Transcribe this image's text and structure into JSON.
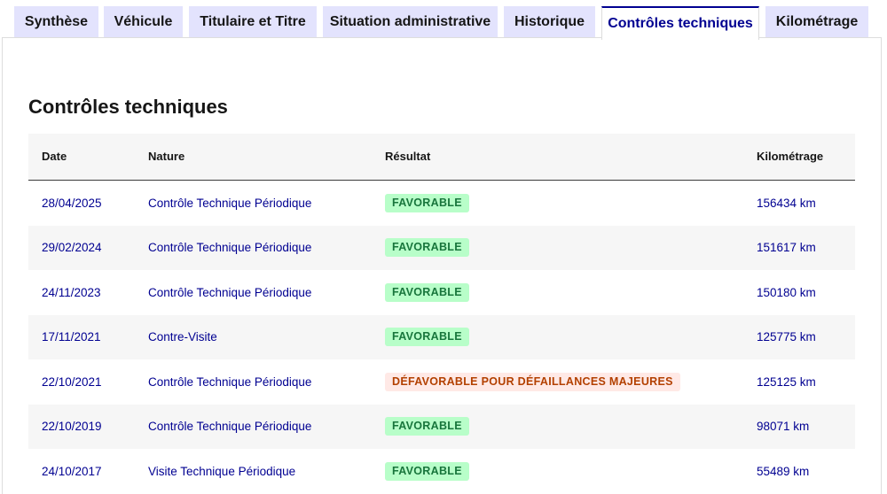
{
  "tabs": [
    {
      "label": "Synthèse",
      "active": false
    },
    {
      "label": "Véhicule",
      "active": false
    },
    {
      "label": "Titulaire et Titre",
      "active": false
    },
    {
      "label": "Situation administrative",
      "active": false
    },
    {
      "label": "Historique",
      "active": false
    },
    {
      "label": "Contrôles techniques",
      "active": true
    },
    {
      "label": "Kilométrage",
      "active": false
    }
  ],
  "section": {
    "title": "Contrôles techniques"
  },
  "table": {
    "headers": {
      "date": "Date",
      "nature": "Nature",
      "result": "Résultat",
      "km": "Kilométrage"
    },
    "rows": [
      {
        "date": "28/04/2025",
        "nature": "Contrôle Technique Périodique",
        "result": "FAVORABLE",
        "status": "favorable",
        "km": "156434 km"
      },
      {
        "date": "29/02/2024",
        "nature": "Contrôle Technique Périodique",
        "result": "FAVORABLE",
        "status": "favorable",
        "km": "151617 km"
      },
      {
        "date": "24/11/2023",
        "nature": "Contrôle Technique Périodique",
        "result": "FAVORABLE",
        "status": "favorable",
        "km": "150180 km"
      },
      {
        "date": "17/11/2021",
        "nature": "Contre-Visite",
        "result": "FAVORABLE",
        "status": "favorable",
        "km": "125775 km"
      },
      {
        "date": "22/10/2021",
        "nature": "Contrôle Technique Périodique",
        "result": "DÉFAVORABLE POUR DÉFAILLANCES MAJEURES",
        "status": "defavorable",
        "km": "125125 km"
      },
      {
        "date": "22/10/2019",
        "nature": "Contrôle Technique Périodique",
        "result": "FAVORABLE",
        "status": "favorable",
        "km": "98071 km"
      },
      {
        "date": "24/10/2017",
        "nature": "Visite Technique Périodique",
        "result": "FAVORABLE",
        "status": "favorable",
        "km": "55489 km"
      }
    ]
  },
  "colors": {
    "accent": "#000091",
    "tab_bg": "#e3e3fd",
    "favorable_bg": "#b8fec9",
    "favorable_text": "#18753c",
    "defavorable_bg": "#ffe9e6",
    "defavorable_text": "#b34000"
  }
}
